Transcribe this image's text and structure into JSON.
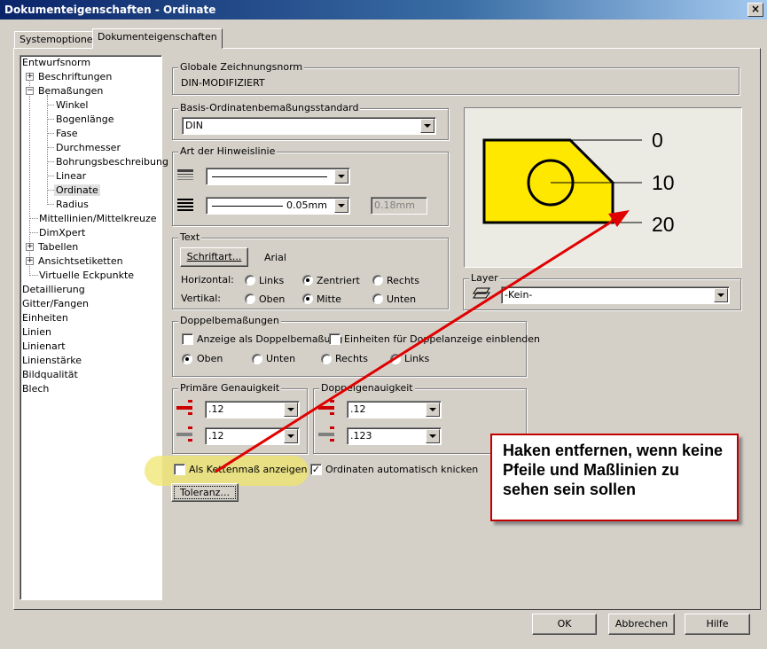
{
  "window": {
    "title": "Dokumenteigenschaften - Ordinate",
    "close_glyph": "×"
  },
  "tabs": [
    {
      "label": "Systemoptionen",
      "active": false
    },
    {
      "label": "Dokumenteigenschaften",
      "active": true
    }
  ],
  "tree": {
    "items": [
      {
        "label": "Entwurfsnorm"
      },
      {
        "label": "Beschriftungen",
        "expander": "+"
      },
      {
        "label": "Bemaßungen",
        "expander": "−"
      },
      {
        "label": "Winkel"
      },
      {
        "label": "Bogenlänge"
      },
      {
        "label": "Fase"
      },
      {
        "label": "Durchmesser"
      },
      {
        "label": "Bohrungsbeschreibung"
      },
      {
        "label": "Linear"
      },
      {
        "label": "Ordinate",
        "selected": true
      },
      {
        "label": "Radius"
      },
      {
        "label": "Mittellinien/Mittelkreuze"
      },
      {
        "label": "DimXpert"
      },
      {
        "label": "Tabellen",
        "expander": "+"
      },
      {
        "label": "Ansichtsetiketten",
        "expander": "+"
      },
      {
        "label": "Virtuelle Eckpunkte"
      },
      {
        "label": "Detaillierung"
      },
      {
        "label": "Gitter/Fangen"
      },
      {
        "label": "Einheiten"
      },
      {
        "label": "Linien"
      },
      {
        "label": "Linienart"
      },
      {
        "label": "Linienstärke"
      },
      {
        "label": "Bildqualität"
      },
      {
        "label": "Blech"
      }
    ]
  },
  "global_norm": {
    "title": "Globale Zeichnungsnorm",
    "value": "DIN-MODIFIZIERT"
  },
  "base_standard": {
    "title": "Basis-Ordinatenbemaßungsstandard",
    "value": "DIN"
  },
  "leader": {
    "title": "Art der Hinweislinie",
    "thickness_value": "0.05mm",
    "custom_value": "0.18mm"
  },
  "text": {
    "title": "Text",
    "font_button": "Schriftart...",
    "font_name": "Arial",
    "horizontal_label": "Horizontal:",
    "vertical_label": "Vertikal:",
    "h_left": "Links",
    "h_center": "Zentriert",
    "h_right": "Rechts",
    "v_top": "Oben",
    "v_middle": "Mitte",
    "v_bottom": "Unten"
  },
  "dual": {
    "title": "Doppelbemaßungen",
    "show_dual": "Anzeige als Doppelbemaßung",
    "show_units": "Einheiten für Doppelanzeige einblenden",
    "pos_top": "Oben",
    "pos_bottom": "Unten",
    "pos_right": "Rechts",
    "pos_left": "Links"
  },
  "primary_precision": {
    "title": "Primäre Genauigkeit",
    "value1": ".12",
    "value2": ".12"
  },
  "dual_precision": {
    "title": "Doppelgenauigkeit",
    "value1": ".12",
    "value2": ".123"
  },
  "chain": {
    "label": "Als Kettenmaß anzeigen",
    "checked": false
  },
  "auto_jog": {
    "label": "Ordinaten automatisch knicken",
    "checked": true
  },
  "tolerance_button": "Toleranz...",
  "preview": {
    "labels": [
      "0",
      "10",
      "20"
    ],
    "fill_color": "#ffe800"
  },
  "layer": {
    "title": "Layer",
    "value": "-Kein-"
  },
  "callout": {
    "text": "Haken entfernen, wenn keine Pfeile und Maßlinien zu sehen sein sollen"
  },
  "buttons": {
    "ok": "OK",
    "cancel": "Abbrechen",
    "help": "Hilfe"
  }
}
